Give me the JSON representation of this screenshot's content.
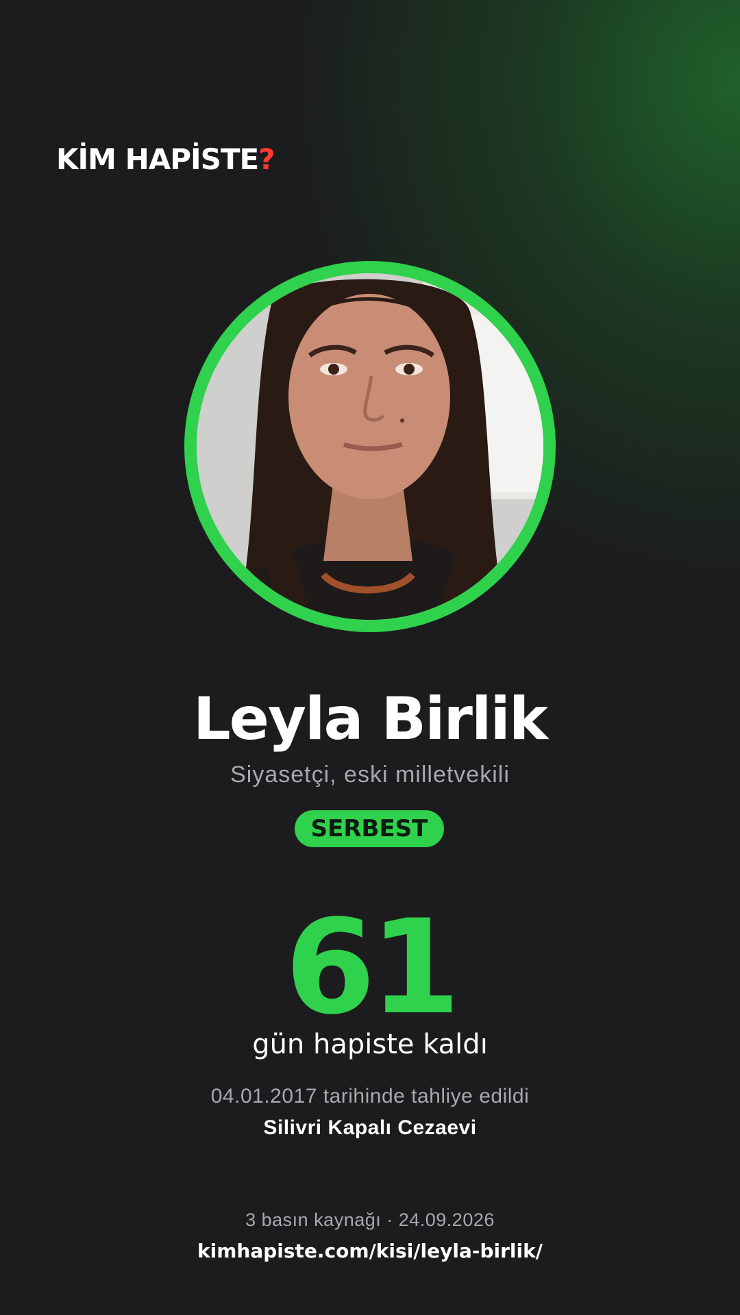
{
  "brand": {
    "logo_text": "KİM HAPİSTE",
    "logo_mark": "?",
    "logo_mark_color": "#ff3b30"
  },
  "person": {
    "name": "Leyla Birlik",
    "role": "Siyasetçi, eski milletvekili",
    "status": "SERBEST",
    "photo_icon": "person-portrait-icon"
  },
  "detention": {
    "days": "61",
    "days_label": "gün hapiste kaldı",
    "release_text": "04.01.2017 tarihinde tahliye edildi",
    "prison": "Silivri Kapalı Cezaevi"
  },
  "footer": {
    "sources": "3 basın kaynağı · 24.09.2026",
    "url": "kimhapiste.com/kisi/leyla-birlik/"
  },
  "colors": {
    "accent": "#30d14d",
    "background": "#1c1c1e",
    "muted_text": "#a9a9ad"
  }
}
